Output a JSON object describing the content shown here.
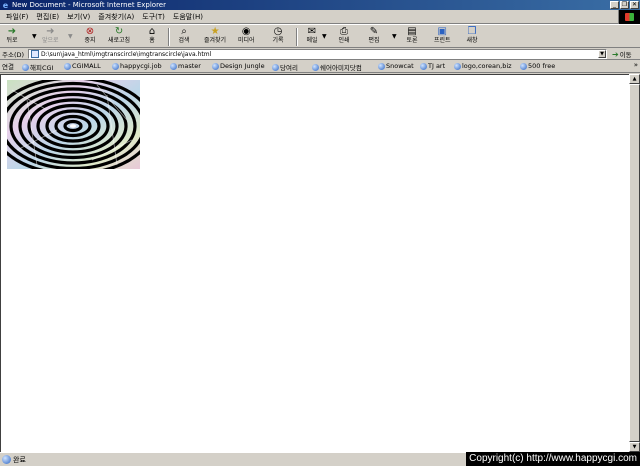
{
  "window": {
    "title": "New Document - Microsoft Internet Explorer",
    "minimize": "_",
    "restore": "❐",
    "close": "✕"
  },
  "menu": [
    "파일(F)",
    "편집(E)",
    "보기(V)",
    "즐겨찾기(A)",
    "도구(T)",
    "도움말(H)"
  ],
  "toolbar": {
    "back": "뒤로",
    "forward": "앞으로",
    "stop": "중지",
    "refresh": "새로고침",
    "home": "홈",
    "search": "검색",
    "favorites": "즐겨찾기",
    "media": "미디어",
    "history": "기록",
    "mail": "메일",
    "print": "인쇄",
    "edit": "편집",
    "discuss": "토론",
    "printer2": "프린트",
    "messenger": "새창"
  },
  "address": {
    "label": "주소(D)",
    "url": "D:\\sun\\java_html\\imgtranscircle\\imgtranscircle\\java.html",
    "go": "이동"
  },
  "links": {
    "label": "연결",
    "items": [
      "해피CGI",
      "CGIMALL",
      "happycgi.job",
      "master",
      "Design Jungle",
      "당여리",
      "쉐어아미지닷컴",
      "Snowcat",
      "TJ art",
      "logo,corean,biz",
      "500 free"
    ]
  },
  "status": {
    "text": "완료"
  },
  "copyright": "Copyright(c) http://www.happycgi.com"
}
